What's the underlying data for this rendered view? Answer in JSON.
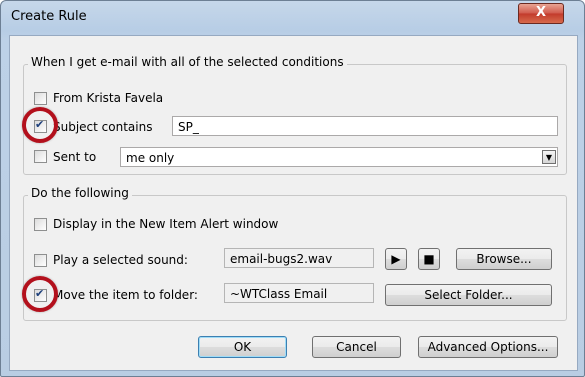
{
  "window": {
    "title": "Create Rule",
    "close_glyph": "X"
  },
  "conditions": {
    "heading": "When I get e-mail with all of the selected conditions",
    "from": {
      "label": "From Krista Favela",
      "checked": false
    },
    "subject": {
      "label": "Subject contains",
      "checked": true,
      "value": "SP_"
    },
    "sent_to": {
      "label": "Sent to",
      "checked": false,
      "value": "me only"
    }
  },
  "actions": {
    "heading": "Do the following",
    "display_alert": {
      "label": "Display in the New Item Alert window",
      "checked": false
    },
    "play_sound": {
      "label": "Play a selected sound:",
      "checked": false,
      "value": "email-bugs2.wav",
      "browse_label": "Browse..."
    },
    "move_folder": {
      "label": "Move the item to folder:",
      "checked": true,
      "value": "~WTClass Email",
      "select_label": "Select Folder..."
    }
  },
  "footer": {
    "ok_label": "OK",
    "cancel_label": "Cancel",
    "advanced_label": "Advanced Options..."
  },
  "annotation_color": "#b3101c"
}
